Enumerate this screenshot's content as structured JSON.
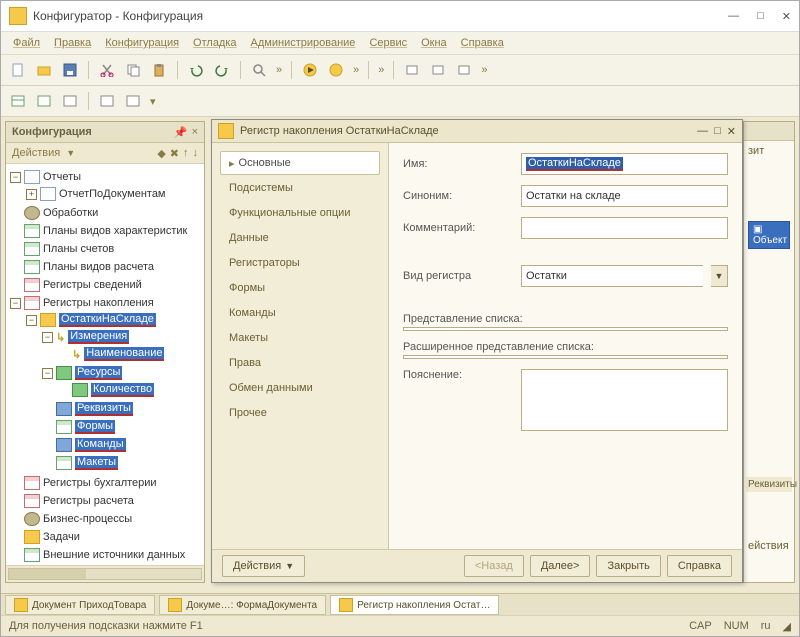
{
  "title": "Конфигуратор - Конфигурация",
  "menu": [
    "Файл",
    "Правка",
    "Конфигурация",
    "Отладка",
    "Администрирование",
    "Сервис",
    "Окна",
    "Справка"
  ],
  "panel": {
    "title": "Конфигурация",
    "actions_label": "Действия",
    "tree": {
      "n0": "Отчеты",
      "n1": "ОтчетПоДокументам",
      "n2": "Обработки",
      "n3": "Планы видов характеристик",
      "n4": "Планы счетов",
      "n5": "Планы видов расчета",
      "n6": "Регистры сведений",
      "n7": "Регистры накопления",
      "n8": "ОстаткиНаСкладе",
      "n9": "Измерения",
      "n10": "Наименование",
      "n11": "Ресурсы",
      "n12": "Количество",
      "n13": "Реквизиты",
      "n14": "Формы",
      "n15": "Команды",
      "n16": "Макеты",
      "n17": "Регистры бухгалтерии",
      "n18": "Регистры расчета",
      "n19": "Бизнес-процессы",
      "n20": "Задачи",
      "n21": "Внешние источники данных"
    }
  },
  "inner": {
    "title": "Регистр накопления ОстаткиНаСкладе",
    "tabs": [
      "Основные",
      "Подсистемы",
      "Функциональные опции",
      "Данные",
      "Регистраторы",
      "Формы",
      "Команды",
      "Макеты",
      "Права",
      "Обмен данными",
      "Прочее"
    ],
    "labels": {
      "name": "Имя:",
      "synonym": "Синоним:",
      "comment": "Комментарий:",
      "regtype": "Вид регистра",
      "listrep": "Представление списка:",
      "extlistrep": "Расширенное представление списка:",
      "explain": "Пояснение:"
    },
    "values": {
      "name": "ОстаткиНаСкладе",
      "synonym": "Остатки на складе",
      "comment": "",
      "regtype": "Остатки",
      "listrep": "",
      "extlistrep": ""
    },
    "footer": {
      "actions": "Действия",
      "back": "<Назад",
      "next": "Далее>",
      "close": "Закрыть",
      "help": "Справка"
    }
  },
  "right": {
    "zit": "зит",
    "object": "Объект",
    "rekv": "Реквизиты",
    "actions": "ействия"
  },
  "wintabs": [
    "Документ ПриходТовара",
    "Докуме…: ФормаДокумента",
    "Регистр накопления Остат…"
  ],
  "status": {
    "hint": "Для получения подсказки нажмите F1",
    "cap": "CAP",
    "num": "NUM",
    "lang": "ru"
  }
}
